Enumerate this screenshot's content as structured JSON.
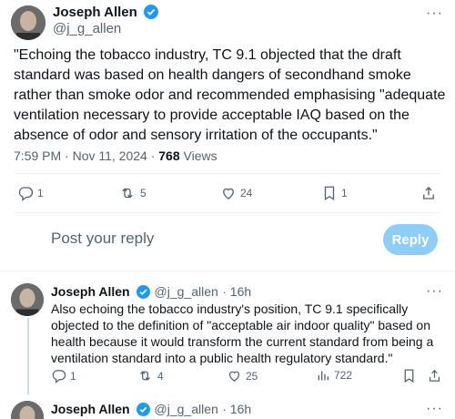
{
  "main_tweet": {
    "author_name": "Joseph Allen",
    "author_handle": "@j_g_allen",
    "text": "\"Echoing the tobacco industry, TC 9.1 objected that the draft standard was based on health dangers of secondhand smoke rather than smoke odor and recommended emphasising \"adequate ventilation necessary to provide acceptable IAQ based on the absence of odor and sensory irritation of the occupants.\"",
    "time": "7:59 PM · Nov 11, 2024 · ",
    "views_count": "768",
    "views_label": " Views",
    "replies": "1",
    "retweets": "5",
    "likes": "24",
    "bookmarks": "1"
  },
  "composer": {
    "placeholder": "Post your reply",
    "button_label": "Reply"
  },
  "thread": [
    {
      "author_name": "Joseph Allen",
      "author_handle": "@j_g_allen",
      "age": "· 16h",
      "text": "Also echoing the tobacco industry's position, TC 9.1 specifically objected to the definition of \"acceptable air indoor quality\" based on health because it would transform the current standard from being a ventilation standard into a public health regulatory standard.\"",
      "replies": "1",
      "retweets": "4",
      "likes": "25",
      "views": "722"
    },
    {
      "author_name": "Joseph Allen",
      "author_handle": "@j_g_allen",
      "age": "· 16h"
    }
  ],
  "colors": {
    "verified": "#1d9bf0",
    "reply_button": "#8ecdf8",
    "muted": "#536471"
  }
}
